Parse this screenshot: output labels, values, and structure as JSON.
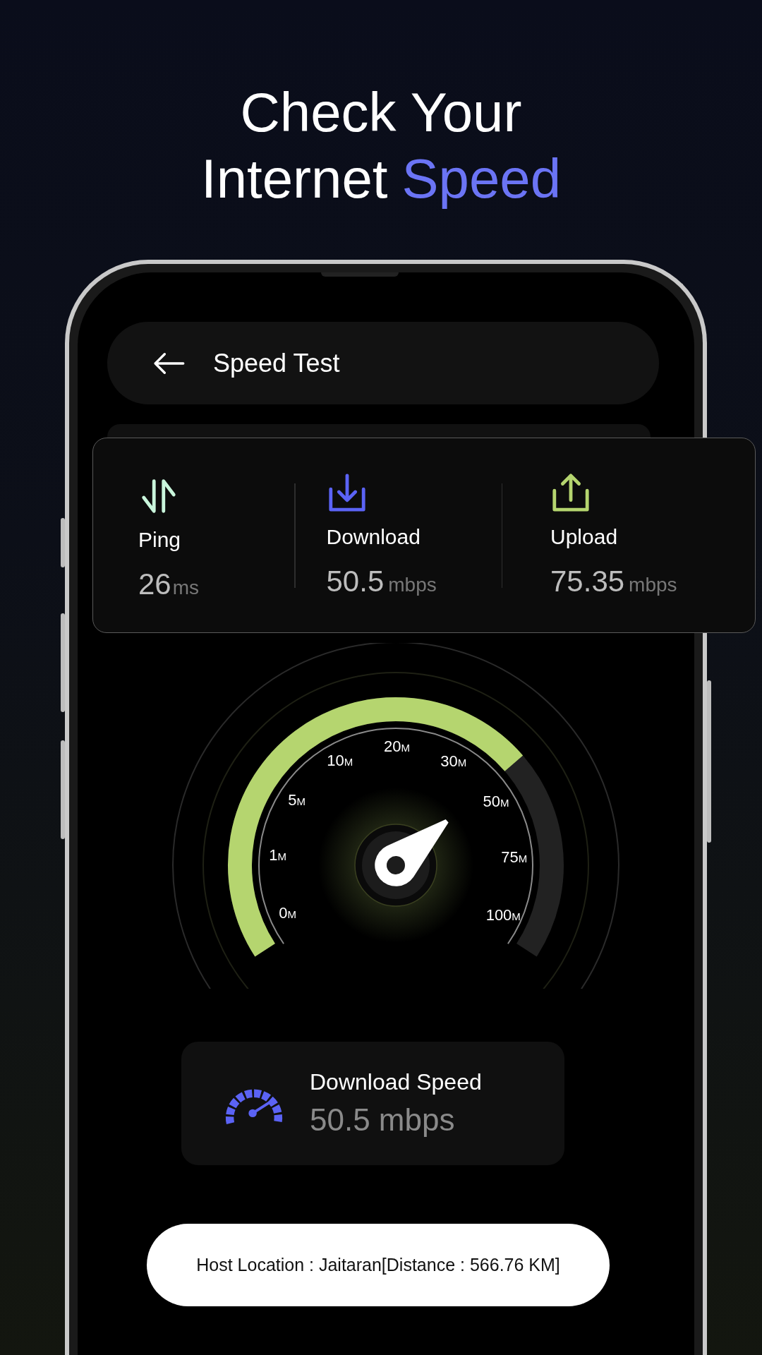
{
  "headline": {
    "line_1": "Check Your",
    "line_2": "Internet",
    "highlight": "Speed"
  },
  "header": {
    "title": "Speed Test"
  },
  "stats": [
    {
      "kind": "ping",
      "label": "Ping",
      "value": "26",
      "unit": "ms"
    },
    {
      "kind": "download",
      "label": "Download",
      "value": "50.5",
      "unit": "mbps"
    },
    {
      "kind": "upload",
      "label": "Upload",
      "value": "75.35",
      "unit": "mbps"
    }
  ],
  "gauge": {
    "ticks": [
      {
        "value": "0",
        "unit": "M"
      },
      {
        "value": "1",
        "unit": "M"
      },
      {
        "value": "5",
        "unit": "M"
      },
      {
        "value": "10",
        "unit": "M"
      },
      {
        "value": "20",
        "unit": "M"
      },
      {
        "value": "30",
        "unit": "M"
      },
      {
        "value": "50",
        "unit": "M"
      },
      {
        "value": "75",
        "unit": "M"
      },
      {
        "value": "100",
        "unit": "M"
      }
    ]
  },
  "current": {
    "label": "Download Speed",
    "value": "50.5 mbps"
  },
  "host": "Host Location : Jaitaran[Distance : 566.76 KM]"
}
